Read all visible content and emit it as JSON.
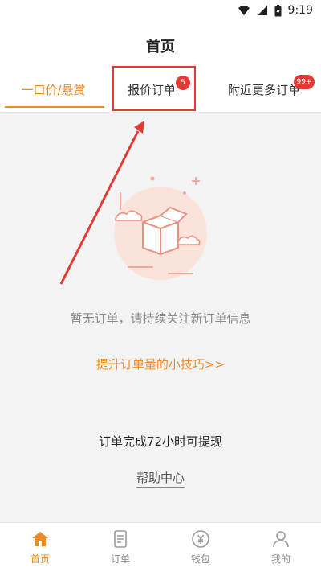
{
  "status_bar": {
    "time": "9:19",
    "icons": [
      "wifi-icon",
      "signal-icon",
      "battery-icon"
    ]
  },
  "header": {
    "title": "首页"
  },
  "tabs": [
    {
      "label": "一口价/悬赏",
      "active": true
    },
    {
      "label": "报价订单",
      "badge": "5"
    },
    {
      "label": "附近更多订单",
      "badge": "99+"
    }
  ],
  "main": {
    "empty_text": "暂无订单，请持续关注新订单信息",
    "tips_link": "提升订单量的小技巧>>",
    "withdraw_note": "订单完成72小时可提现",
    "help_link": "帮助中心"
  },
  "tabbar": [
    {
      "label": "首页",
      "icon": "home-icon",
      "active": true
    },
    {
      "label": "订单",
      "icon": "order-icon"
    },
    {
      "label": "钱包",
      "icon": "wallet-icon"
    },
    {
      "label": "我的",
      "icon": "profile-icon"
    }
  ],
  "colors": {
    "accent": "#f08a24",
    "badge": "#e53935",
    "annotation": "#e53935"
  }
}
